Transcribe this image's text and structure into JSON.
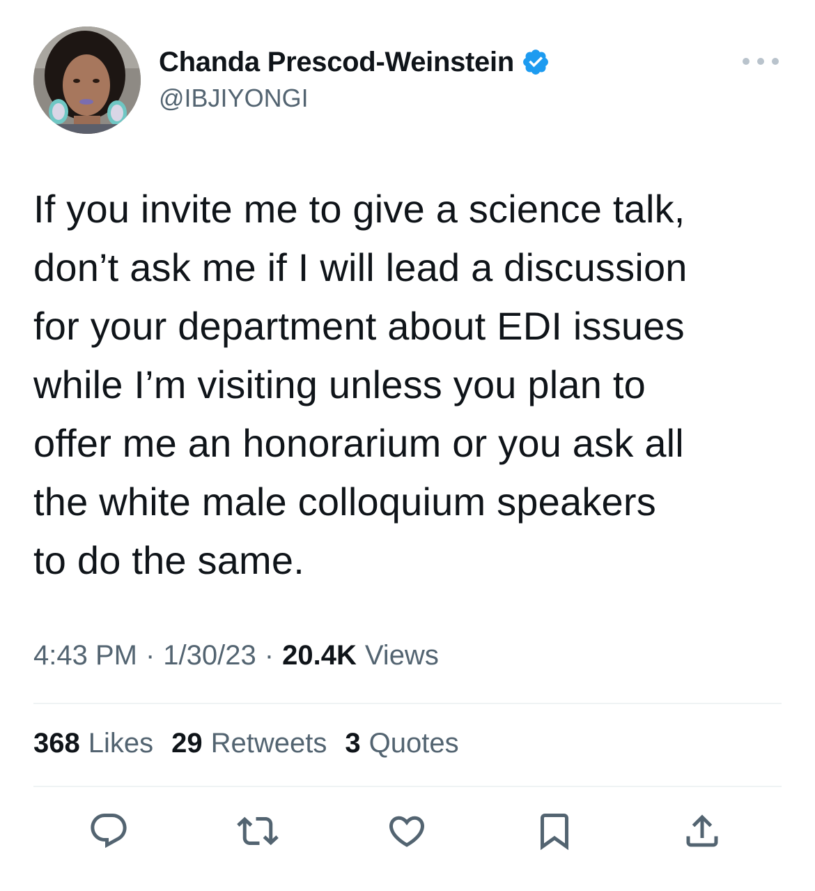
{
  "author": {
    "display_name": "Chanda Prescod-Weinstein",
    "handle": "@IBJIYONGI",
    "verified": true
  },
  "tweet": {
    "text_lines": [
      "If you invite me to give a science talk,",
      "don’t ask me if I will lead a discussion",
      "for your department about EDI issues",
      "while I’m visiting unless you plan to",
      "offer me an honorarium or you ask all",
      "the white male colloquium speakers",
      "to do the same."
    ]
  },
  "meta": {
    "time": "4:43 PM",
    "separator": "·",
    "date": "1/30/23",
    "views_count": "20.4K",
    "views_label": "Views"
  },
  "stats": {
    "likes_count": "368",
    "likes_label": "Likes",
    "retweets_count": "29",
    "retweets_label": "Retweets",
    "quotes_count": "3",
    "quotes_label": "Quotes"
  },
  "icons": {
    "more": "more-options-icon",
    "verified": "verified-badge-icon",
    "reply": "reply-icon",
    "retweet": "retweet-icon",
    "like": "like-icon",
    "bookmark": "bookmark-icon",
    "share": "share-icon"
  },
  "colors": {
    "text_primary": "#0f1419",
    "text_secondary": "#536471",
    "verified_blue": "#1d9bf0",
    "divider": "#eff3f4"
  }
}
